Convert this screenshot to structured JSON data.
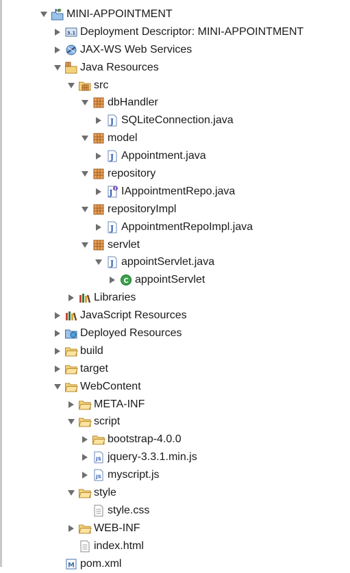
{
  "tree": {
    "items": [
      {
        "label": "MINI-APPOINTMENT",
        "depth": 0,
        "toggle": "open",
        "icon": "maven-project-icon",
        "name": "project-mini-appointment"
      },
      {
        "label": "Deployment Descriptor: MINI-APPOINTMENT",
        "depth": 1,
        "toggle": "closed",
        "icon": "deployment-descriptor-icon",
        "name": "deployment-descriptor"
      },
      {
        "label": "JAX-WS Web Services",
        "depth": 1,
        "toggle": "closed",
        "icon": "web-services-icon",
        "name": "jax-ws-web-services"
      },
      {
        "label": "Java Resources",
        "depth": 1,
        "toggle": "open",
        "icon": "java-resources-icon",
        "name": "java-resources"
      },
      {
        "label": "src",
        "depth": 2,
        "toggle": "open",
        "icon": "source-folder-icon",
        "name": "src-folder"
      },
      {
        "label": "dbHandler",
        "depth": 3,
        "toggle": "open",
        "icon": "package-icon",
        "name": "package-dbhandler"
      },
      {
        "label": "SQLiteConnection.java",
        "depth": 4,
        "toggle": "closed",
        "icon": "java-file-icon",
        "name": "file-sqliteconnection-java"
      },
      {
        "label": "model",
        "depth": 3,
        "toggle": "open",
        "icon": "package-icon",
        "name": "package-model"
      },
      {
        "label": "Appointment.java",
        "depth": 4,
        "toggle": "closed",
        "icon": "java-file-icon",
        "name": "file-appointment-java"
      },
      {
        "label": "repository",
        "depth": 3,
        "toggle": "open",
        "icon": "package-icon",
        "name": "package-repository"
      },
      {
        "label": "IAppointmentRepo.java",
        "depth": 4,
        "toggle": "closed",
        "icon": "java-interface-file-icon",
        "name": "file-iappointmentrepo-java"
      },
      {
        "label": "repositoryImpl",
        "depth": 3,
        "toggle": "open",
        "icon": "package-icon",
        "name": "package-repositoryimpl"
      },
      {
        "label": "AppointmentRepoImpl.java",
        "depth": 4,
        "toggle": "closed",
        "icon": "java-file-icon",
        "name": "file-appointmentrepoimpl-java"
      },
      {
        "label": "servlet",
        "depth": 3,
        "toggle": "open",
        "icon": "package-icon",
        "name": "package-servlet"
      },
      {
        "label": "appointServlet.java",
        "depth": 4,
        "toggle": "open",
        "icon": "java-file-icon",
        "name": "file-appointservlet-java"
      },
      {
        "label": "appointServlet",
        "depth": 5,
        "toggle": "closed",
        "icon": "java-class-icon",
        "name": "class-appointservlet"
      },
      {
        "label": "Libraries",
        "depth": 2,
        "toggle": "closed",
        "icon": "libraries-icon",
        "name": "libraries"
      },
      {
        "label": "JavaScript Resources",
        "depth": 1,
        "toggle": "closed",
        "icon": "libraries-icon",
        "name": "javascript-resources"
      },
      {
        "label": "Deployed Resources",
        "depth": 1,
        "toggle": "closed",
        "icon": "deployed-resources-icon",
        "name": "deployed-resources"
      },
      {
        "label": "build",
        "depth": 1,
        "toggle": "closed",
        "icon": "folder-icon",
        "name": "folder-build"
      },
      {
        "label": "target",
        "depth": 1,
        "toggle": "closed",
        "icon": "folder-icon",
        "name": "folder-target"
      },
      {
        "label": "WebContent",
        "depth": 1,
        "toggle": "open",
        "icon": "folder-icon",
        "name": "folder-webcontent"
      },
      {
        "label": "META-INF",
        "depth": 2,
        "toggle": "closed",
        "icon": "folder-icon",
        "name": "folder-meta-inf"
      },
      {
        "label": "script",
        "depth": 2,
        "toggle": "open",
        "icon": "folder-icon",
        "name": "folder-script"
      },
      {
        "label": "bootstrap-4.0.0",
        "depth": 3,
        "toggle": "closed",
        "icon": "folder-icon",
        "name": "folder-bootstrap"
      },
      {
        "label": "jquery-3.3.1.min.js",
        "depth": 3,
        "toggle": "closed",
        "icon": "js-file-icon",
        "name": "file-jquery-js"
      },
      {
        "label": "myscript.js",
        "depth": 3,
        "toggle": "closed",
        "icon": "js-file-icon",
        "name": "file-myscript-js"
      },
      {
        "label": "style",
        "depth": 2,
        "toggle": "open",
        "icon": "folder-icon",
        "name": "folder-style"
      },
      {
        "label": "style.css",
        "depth": 3,
        "toggle": "none",
        "icon": "text-file-icon",
        "name": "file-style-css"
      },
      {
        "label": "WEB-INF",
        "depth": 2,
        "toggle": "closed",
        "icon": "folder-icon",
        "name": "folder-web-inf"
      },
      {
        "label": "index.html",
        "depth": 2,
        "toggle": "none",
        "icon": "text-file-icon",
        "name": "file-index-html"
      },
      {
        "label": "pom.xml",
        "depth": 1,
        "toggle": "none",
        "icon": "maven-pom-icon",
        "name": "file-pom-xml"
      }
    ]
  }
}
